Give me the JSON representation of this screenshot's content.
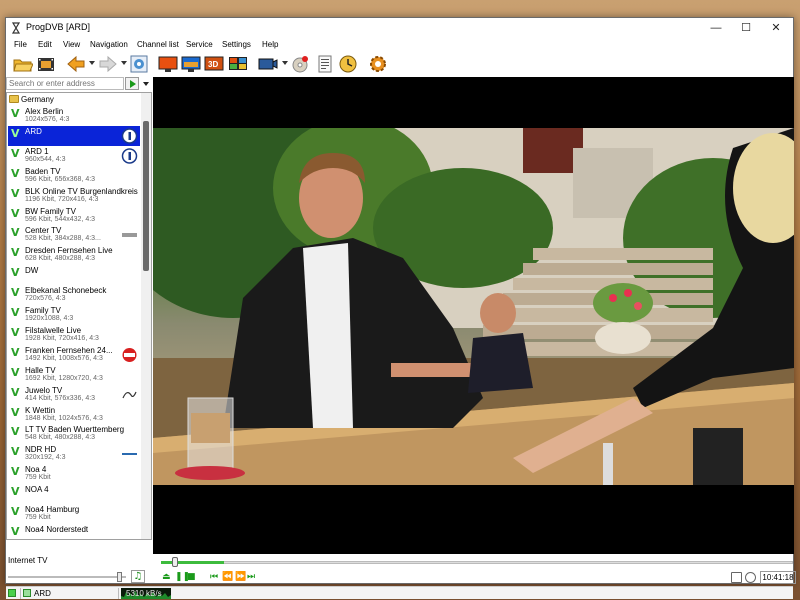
{
  "window": {
    "title": "ProgDVB [ARD]"
  },
  "window_controls": {
    "minimize": "—",
    "maximize": "☐",
    "close": "✕"
  },
  "menu": [
    "File",
    "Edit",
    "View",
    "Navigation",
    "Channel list",
    "Service",
    "Settings",
    "Help"
  ],
  "search": {
    "placeholder": "Search or enter address",
    "value": ""
  },
  "channel_list": {
    "group": "Germany",
    "channels": [
      {
        "name": "Alex Berlin",
        "info": "1024x576, 4:3",
        "logo": ""
      },
      {
        "name": "ARD",
        "info": "",
        "logo": "ard-logo",
        "selected": true
      },
      {
        "name": "ARD 1",
        "info": "960x544, 4:3",
        "logo": "ard-logo"
      },
      {
        "name": "Baden TV",
        "info": "596 Kbit, 656x368, 4:3",
        "logo": ""
      },
      {
        "name": "BLK Online TV Burgenlandkreis",
        "info": "1196 Kbit, 720x416, 4:3",
        "logo": ""
      },
      {
        "name": "BW Family TV",
        "info": "596 Kbit, 544x432, 4:3",
        "logo": ""
      },
      {
        "name": "Center TV",
        "info": "528 Kbit, 384x288, 4:3...",
        "logo": "centertv-logo"
      },
      {
        "name": "Dresden Fernsehen Live",
        "info": "628 Kbit, 480x288, 4:3",
        "logo": ""
      },
      {
        "name": "DW",
        "info": "",
        "logo": ""
      },
      {
        "name": "Elbekanal Schonebeck",
        "info": "720x576, 4:3",
        "logo": ""
      },
      {
        "name": "Family TV",
        "info": "1920x1088, 4:3",
        "logo": ""
      },
      {
        "name": "Filstalwelle Live",
        "info": "1928 Kbit, 720x416, 4:3",
        "logo": ""
      },
      {
        "name": "Franken Fernsehen 24...",
        "info": "1492 Kbit, 1008x576, 4:3",
        "logo": "sat-logo"
      },
      {
        "name": "Halle TV",
        "info": "1692 Kbit, 1280x720, 4:3",
        "logo": ""
      },
      {
        "name": "Juwelo TV",
        "info": "414 Kbit, 576x336, 4:3",
        "logo": "juwelo-logo"
      },
      {
        "name": "K Wettin",
        "info": "1848 Kbit, 1024x576, 4:3",
        "logo": ""
      },
      {
        "name": "LT TV Baden Wuerttemberg",
        "info": "548 Kbit, 480x288, 4:3",
        "logo": ""
      },
      {
        "name": "NDR HD",
        "info": "320x192, 4:3",
        "logo": "ndr-logo"
      },
      {
        "name": "Noa 4",
        "info": "759 Kbit",
        "logo": ""
      },
      {
        "name": "NOA 4",
        "info": "",
        "logo": ""
      },
      {
        "name": "Noa4 Hamburg",
        "info": "759 Kbit",
        "logo": ""
      },
      {
        "name": "Noa4 Norderstedt",
        "info": "",
        "logo": ""
      }
    ]
  },
  "bottom_group": "Internet TV",
  "volume": {
    "level": 0.96
  },
  "playback": {
    "position": 0.1,
    "time": "10:41:18"
  },
  "status": {
    "channel": "ARD",
    "rate": "5310 kB/s"
  },
  "colors": {
    "selection": "#0a24d8",
    "accent_green": "#1a9a1a",
    "video_bg": "#000000"
  }
}
